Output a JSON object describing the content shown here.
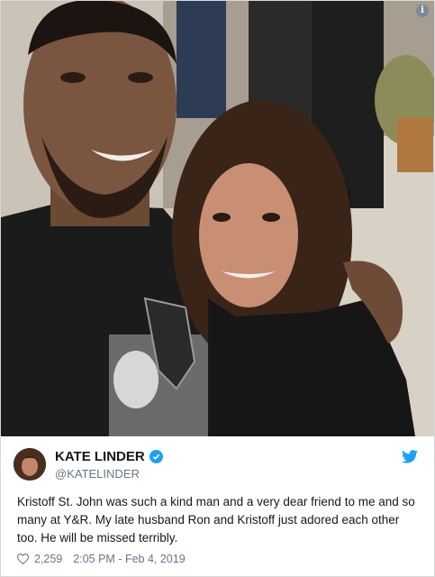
{
  "tweet": {
    "display_name": "KATE LINDER",
    "handle": "@KATELINDER",
    "text": "Kristoff St. John was such a kind man and a very dear friend to me and so many at Y&R. My late husband Ron and Kristoff just adored each other too. He will be missed terribly.",
    "like_count": "2,259",
    "timestamp": "2:05 PM - Feb 4, 2019"
  },
  "icons": {
    "info": "info-icon",
    "verified": "verified-badge-icon",
    "twitter": "twitter-bird-icon",
    "like": "heart-icon"
  },
  "colors": {
    "twitter_blue": "#1da1f2",
    "text_primary": "#14171a",
    "text_secondary": "#657786"
  }
}
